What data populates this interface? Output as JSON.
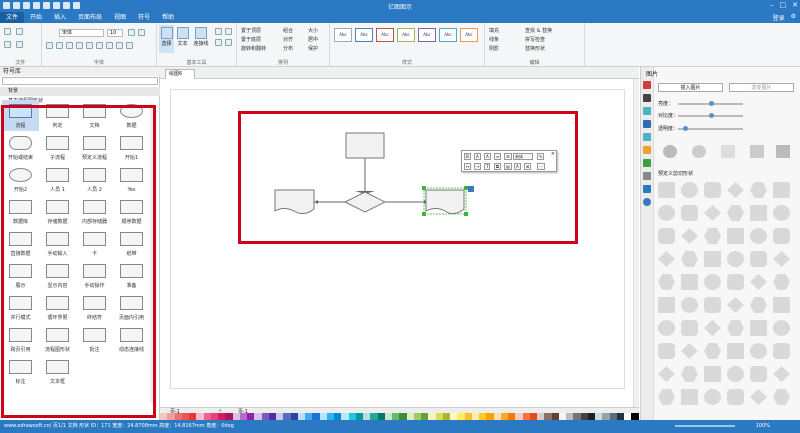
{
  "app": {
    "title": "亿图图示"
  },
  "menu": {
    "items": [
      "文件",
      "开始",
      "插入",
      "页面布局",
      "视图",
      "符号",
      "帮助"
    ],
    "right": [
      "登录",
      "⚙"
    ]
  },
  "ribbon": {
    "font_name": "宋体",
    "font_size": "10",
    "groups": {
      "file": "文件",
      "font": "字体",
      "basic_tools": "基本工具",
      "arrange": "排列",
      "style": "样式",
      "edit": "编辑"
    },
    "tools": {
      "select": "选择",
      "text": "文本",
      "connector": "连接线"
    },
    "arrange": [
      "置于顶层",
      "置于底层",
      "旋转和翻转",
      "组合",
      "对齐",
      "分布",
      "大小",
      "居中",
      "保护"
    ],
    "style_swatches": [
      "Abc",
      "Abc",
      "Abc",
      "Abc",
      "Abc",
      "Abc",
      "Abc"
    ],
    "edit_items": [
      "填充",
      "线条",
      "阴影",
      "查找 & 替换",
      "拼写检查",
      "替换形状"
    ]
  },
  "left_panel": {
    "title": "符号库",
    "library": "背景",
    "sublibrary": "基本流程图形状",
    "shapes": [
      "流程",
      "判定",
      "文档",
      "数据",
      "开始或结束",
      "子流程",
      "预定义流程",
      "开始1",
      "开始2",
      "人员 1",
      "人员 2",
      "Yes",
      "数据库",
      "存储数据",
      "内部存储器",
      "顺序数据",
      "直接数据",
      "手动输入",
      "卡",
      "纸带",
      "展示",
      "显示内容",
      "手动操作",
      "准备",
      "并行模式",
      "循环界限",
      "终结符",
      "页面内引用",
      "跨页引用",
      "流程图形状",
      "批注",
      "动态连接线",
      "标注",
      "文本框"
    ]
  },
  "tabs": {
    "doc": "绘图6"
  },
  "float_toolbar": {
    "font": "宋体"
  },
  "right_panel": {
    "title": "图片",
    "insert_button": "插入图片",
    "replace_button": "改变图片",
    "sliders": [
      {
        "label": "亮度：",
        "value": 0.5
      },
      {
        "label": "对比度：",
        "value": 0.5
      },
      {
        "label": "透明度：",
        "value": 0.1
      }
    ],
    "crop_label": "预定义剪切形状"
  },
  "page_tabs": {
    "first": "页-1",
    "second": "页-1"
  },
  "colors": [
    "#f4c7c3",
    "#f29f9b",
    "#e57373",
    "#ef5350",
    "#e53935",
    "#f8bbd0",
    "#f06292",
    "#ec407a",
    "#d81b60",
    "#ad1457",
    "#e1bee7",
    "#ba68c8",
    "#8e24aa",
    "#d1c4e9",
    "#7e57c2",
    "#512da8",
    "#c5cae9",
    "#5c6bc0",
    "#303f9f",
    "#bbdefb",
    "#42a5f5",
    "#1976d2",
    "#b3e5fc",
    "#29b6f6",
    "#0288d1",
    "#b2ebf2",
    "#26c6da",
    "#0097a7",
    "#b2dfdb",
    "#26a69a",
    "#00796b",
    "#c8e6c9",
    "#66bb6a",
    "#388e3c",
    "#dcedc8",
    "#9ccc65",
    "#689f38",
    "#f0f4c3",
    "#d4e157",
    "#afb42b",
    "#fff9c4",
    "#ffee58",
    "#fbc02d",
    "#ffecb3",
    "#ffca28",
    "#ffa000",
    "#ffe0b2",
    "#ffa726",
    "#f57c00",
    "#ffccbc",
    "#ff7043",
    "#e64a19",
    "#d7ccc8",
    "#8d6e63",
    "#5d4037",
    "#f5f5f5",
    "#bdbdbd",
    "#757575",
    "#424242",
    "#212121",
    "#cfd8dc",
    "#90a4ae",
    "#546e7a",
    "#263238",
    "#ffffff",
    "#000000"
  ],
  "status": {
    "text": "www.edrawsoft.cn/  页1/1  文档 形状 ID：171  宽度：24.8708mm  高度：14.8167mm  角度：0deg",
    "zoom": "100%"
  }
}
